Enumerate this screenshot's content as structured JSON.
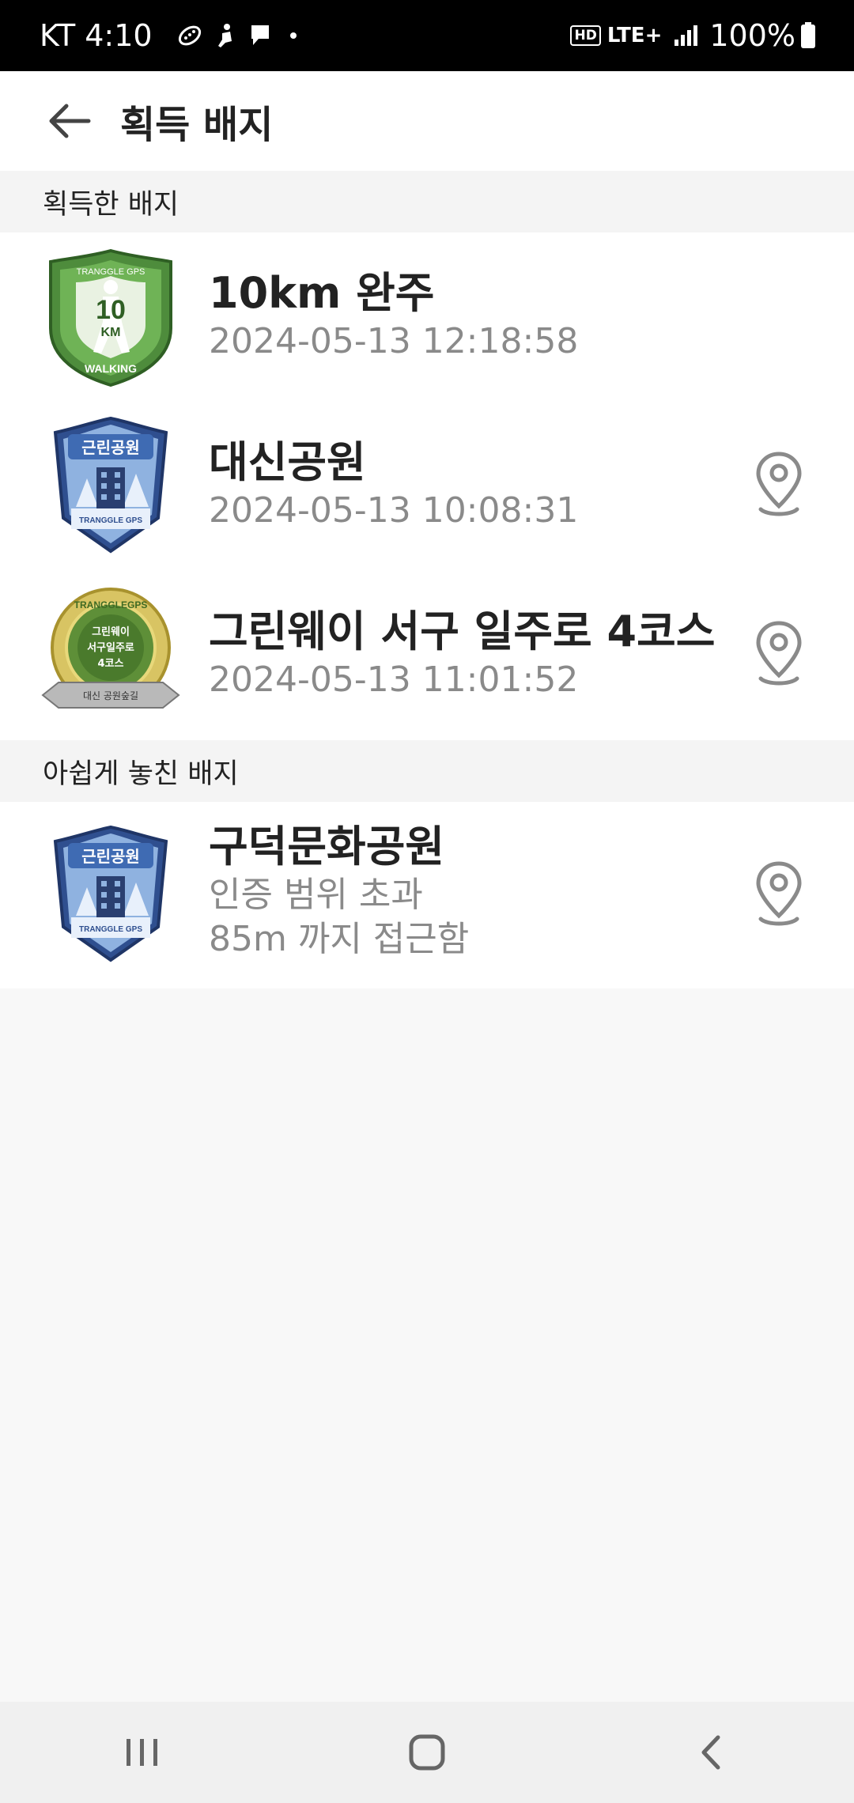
{
  "status_bar": {
    "carrier_time": "KT 4:10",
    "hd": "HD",
    "network": "LTE+",
    "battery": "100%"
  },
  "header": {
    "title": "획득 배지"
  },
  "earned": {
    "section_title": "획득한 배지",
    "items": [
      {
        "title": "10km 완주",
        "subtitle": "2024-05-13 12:18:58",
        "badge": {
          "top": "TRANGGLE GPS",
          "center": "10",
          "unit": "KM",
          "bottom": "WALKING"
        }
      },
      {
        "title": "대신공원",
        "subtitle": "2024-05-13 10:08:31",
        "badge": {
          "top": "근린공원",
          "bottom": "TRANGGLE GPS"
        }
      },
      {
        "title": "그린웨이 서구 일주로 4코스",
        "subtitle": "2024-05-13 11:01:52",
        "badge": {
          "top": "TRANGGLEGPS",
          "line1": "그린웨이",
          "line2": "서구일주로",
          "line3": "4코스",
          "ribbon": "대신 공원숲길"
        }
      }
    ]
  },
  "missed": {
    "section_title": "아쉽게 놓친 배지",
    "items": [
      {
        "title": "구덕문화공원",
        "subtitle1": "인증 범위 초과",
        "subtitle2": "85m 까지 접근함",
        "badge": {
          "top": "근린공원",
          "bottom": "TRANGGLE GPS"
        }
      }
    ]
  },
  "colors": {
    "badge_green": "#5a9a48",
    "badge_blue": "#3f6bb3",
    "badge_gold": "#c8b24a",
    "pin": "#8a8a8a"
  }
}
